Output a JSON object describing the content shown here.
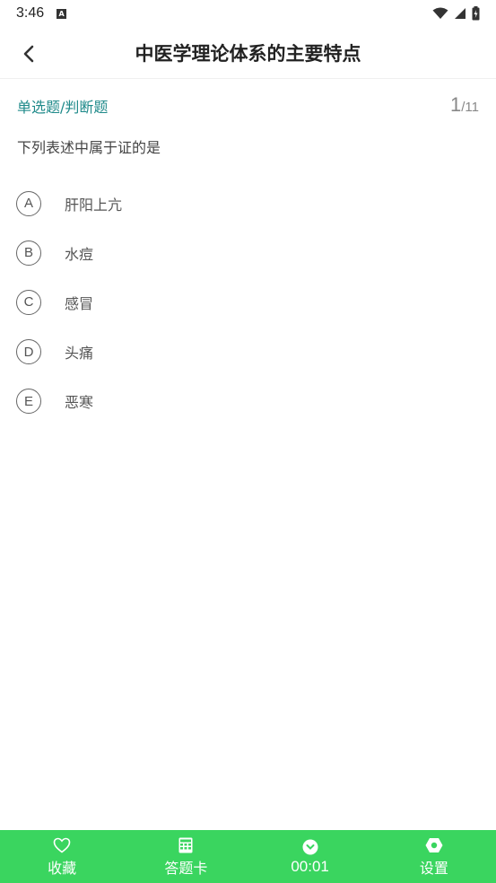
{
  "status_bar": {
    "time": "3:46",
    "notification_icon": "A"
  },
  "header": {
    "title": "中医学理论体系的主要特点"
  },
  "question": {
    "type_label": "单选题/判断题",
    "current": "1",
    "total": "/11",
    "text": "下列表述中属于证的是",
    "options": [
      {
        "letter": "A",
        "text": "肝阳上亢"
      },
      {
        "letter": "B",
        "text": "水痘"
      },
      {
        "letter": "C",
        "text": "感冒"
      },
      {
        "letter": "D",
        "text": "头痛"
      },
      {
        "letter": "E",
        "text": "恶寒"
      }
    ]
  },
  "bottom_bar": {
    "items": [
      {
        "label": "收藏",
        "icon": "heart-icon"
      },
      {
        "label": "答题卡",
        "icon": "grid-card-icon"
      },
      {
        "label": "00:01",
        "icon": "clock-icon"
      },
      {
        "label": "设置",
        "icon": "gear-icon"
      }
    ]
  },
  "colors": {
    "accent_green": "#3ad55f",
    "type_teal": "#1f8a8a"
  }
}
